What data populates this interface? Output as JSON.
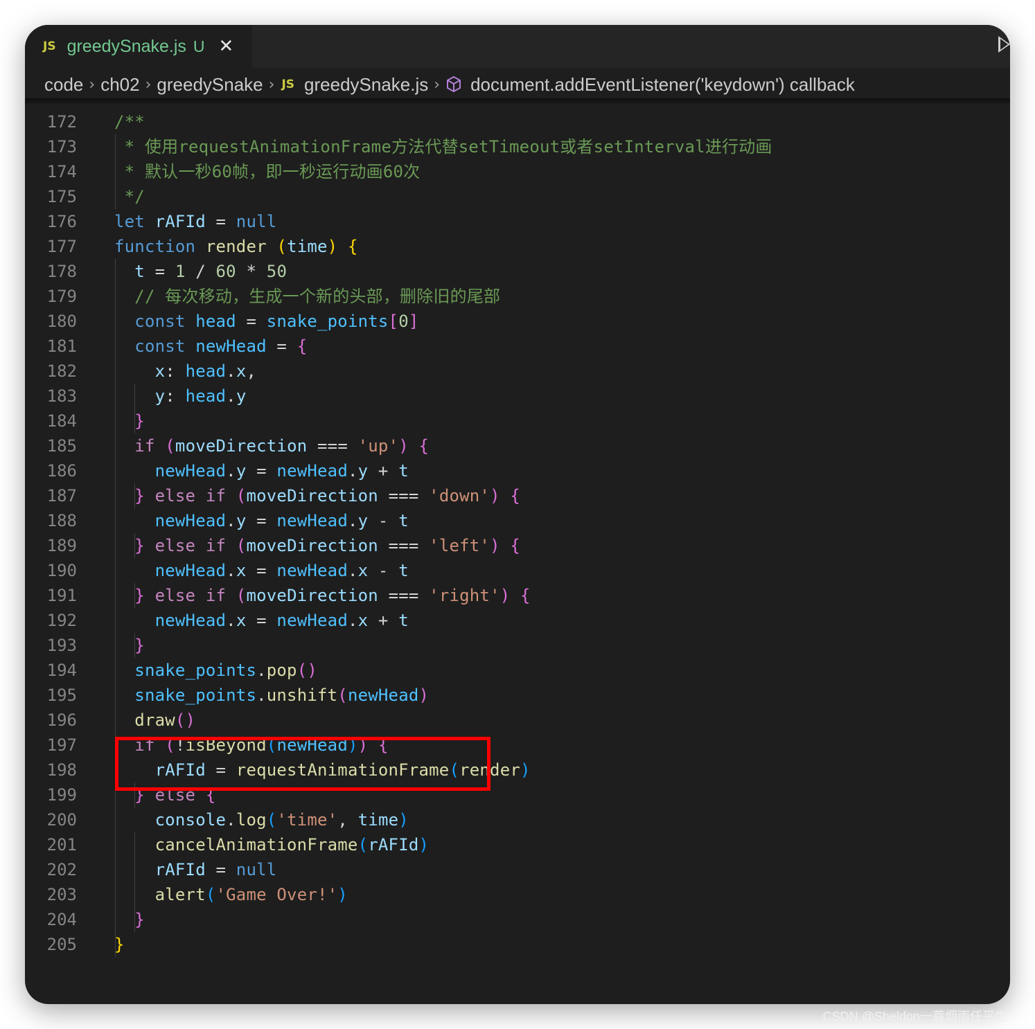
{
  "tab": {
    "icon_label": "JS",
    "title": "greedySnake.js",
    "status": "U",
    "close": "✕"
  },
  "breadcrumb": [
    "code",
    "ch02",
    "greedySnake",
    "greedySnake.js",
    "document.addEventListener('keydown') callback"
  ],
  "breadcrumb_js_badge": "JS",
  "watermark": "CSDN @Sheldon一蓑烟雨任平生",
  "lines": [
    {
      "num": "172",
      "tokens": [
        {
          "t": "/**",
          "c": "c"
        }
      ]
    },
    {
      "num": "173",
      "tokens": [
        {
          "t": " * 使用requestAnimationFrame方法代替setTimeout或者setInterval进行动画",
          "c": "c"
        }
      ]
    },
    {
      "num": "174",
      "tokens": [
        {
          "t": " * 默认一秒60帧，即一秒运行动画60次",
          "c": "c"
        }
      ]
    },
    {
      "num": "175",
      "tokens": [
        {
          "t": " */",
          "c": "c"
        }
      ]
    },
    {
      "num": "176",
      "tokens": [
        {
          "t": "let",
          "c": "k"
        },
        {
          "t": " rAFId ",
          "c": "v"
        },
        {
          "t": "=",
          "c": "o"
        },
        {
          "t": " null",
          "c": "k"
        }
      ]
    },
    {
      "num": "177",
      "tokens": [
        {
          "t": "function",
          "c": "k"
        },
        {
          "t": " render ",
          "c": "f"
        },
        {
          "t": "(",
          "c": "b1"
        },
        {
          "t": "time",
          "c": "v"
        },
        {
          "t": ")",
          "c": "b1"
        },
        {
          "t": " {",
          "c": "b1"
        }
      ]
    },
    {
      "num": "178",
      "tokens": [
        {
          "t": "  t ",
          "c": "v"
        },
        {
          "t": "= ",
          "c": "o"
        },
        {
          "t": "1",
          "c": "n"
        },
        {
          "t": " / ",
          "c": "o"
        },
        {
          "t": "60",
          "c": "n"
        },
        {
          "t": " * ",
          "c": "o"
        },
        {
          "t": "50",
          "c": "n"
        }
      ]
    },
    {
      "num": "179",
      "tokens": [
        {
          "t": "  // 每次移动，生成一个新的头部，删除旧的尾部",
          "c": "c"
        }
      ]
    },
    {
      "num": "180",
      "tokens": [
        {
          "t": "  const",
          "c": "k"
        },
        {
          "t": " head",
          "c": "cn"
        },
        {
          "t": " = ",
          "c": "o"
        },
        {
          "t": "snake_points",
          "c": "cn"
        },
        {
          "t": "[",
          "c": "b2"
        },
        {
          "t": "0",
          "c": "n"
        },
        {
          "t": "]",
          "c": "b2"
        }
      ]
    },
    {
      "num": "181",
      "tokens": [
        {
          "t": "  const",
          "c": "k"
        },
        {
          "t": " newHead",
          "c": "cn"
        },
        {
          "t": " = ",
          "c": "o"
        },
        {
          "t": "{",
          "c": "b2"
        }
      ]
    },
    {
      "num": "182",
      "tokens": [
        {
          "t": "    x",
          "c": "v"
        },
        {
          "t": ": ",
          "c": "o"
        },
        {
          "t": "head",
          "c": "cn"
        },
        {
          "t": ".",
          "c": "o"
        },
        {
          "t": "x",
          "c": "v"
        },
        {
          "t": ",",
          "c": "o"
        }
      ]
    },
    {
      "num": "183",
      "tokens": [
        {
          "t": "    y",
          "c": "v"
        },
        {
          "t": ": ",
          "c": "o"
        },
        {
          "t": "head",
          "c": "cn"
        },
        {
          "t": ".",
          "c": "o"
        },
        {
          "t": "y",
          "c": "v"
        }
      ]
    },
    {
      "num": "184",
      "tokens": [
        {
          "t": "  }",
          "c": "b2"
        }
      ]
    },
    {
      "num": "185",
      "tokens": [
        {
          "t": "  if",
          "c": "p"
        },
        {
          "t": " (",
          "c": "b2"
        },
        {
          "t": "moveDirection",
          "c": "v"
        },
        {
          "t": " === ",
          "c": "o"
        },
        {
          "t": "'up'",
          "c": "s"
        },
        {
          "t": ")",
          "c": "b2"
        },
        {
          "t": " {",
          "c": "b2"
        }
      ]
    },
    {
      "num": "186",
      "tokens": [
        {
          "t": "    newHead",
          "c": "cn"
        },
        {
          "t": ".",
          "c": "o"
        },
        {
          "t": "y",
          "c": "v"
        },
        {
          "t": " = ",
          "c": "o"
        },
        {
          "t": "newHead",
          "c": "cn"
        },
        {
          "t": ".",
          "c": "o"
        },
        {
          "t": "y",
          "c": "v"
        },
        {
          "t": " + ",
          "c": "o"
        },
        {
          "t": "t",
          "c": "v"
        }
      ]
    },
    {
      "num": "187",
      "tokens": [
        {
          "t": "  }",
          "c": "b2"
        },
        {
          "t": " else if",
          "c": "p"
        },
        {
          "t": " (",
          "c": "b2"
        },
        {
          "t": "moveDirection",
          "c": "v"
        },
        {
          "t": " === ",
          "c": "o"
        },
        {
          "t": "'down'",
          "c": "s"
        },
        {
          "t": ")",
          "c": "b2"
        },
        {
          "t": " {",
          "c": "b2"
        }
      ]
    },
    {
      "num": "188",
      "tokens": [
        {
          "t": "    newHead",
          "c": "cn"
        },
        {
          "t": ".",
          "c": "o"
        },
        {
          "t": "y",
          "c": "v"
        },
        {
          "t": " = ",
          "c": "o"
        },
        {
          "t": "newHead",
          "c": "cn"
        },
        {
          "t": ".",
          "c": "o"
        },
        {
          "t": "y",
          "c": "v"
        },
        {
          "t": " - ",
          "c": "o"
        },
        {
          "t": "t",
          "c": "v"
        }
      ]
    },
    {
      "num": "189",
      "tokens": [
        {
          "t": "  }",
          "c": "b2"
        },
        {
          "t": " else if",
          "c": "p"
        },
        {
          "t": " (",
          "c": "b2"
        },
        {
          "t": "moveDirection",
          "c": "v"
        },
        {
          "t": " === ",
          "c": "o"
        },
        {
          "t": "'left'",
          "c": "s"
        },
        {
          "t": ")",
          "c": "b2"
        },
        {
          "t": " {",
          "c": "b2"
        }
      ]
    },
    {
      "num": "190",
      "tokens": [
        {
          "t": "    newHead",
          "c": "cn"
        },
        {
          "t": ".",
          "c": "o"
        },
        {
          "t": "x",
          "c": "v"
        },
        {
          "t": " = ",
          "c": "o"
        },
        {
          "t": "newHead",
          "c": "cn"
        },
        {
          "t": ".",
          "c": "o"
        },
        {
          "t": "x",
          "c": "v"
        },
        {
          "t": " - ",
          "c": "o"
        },
        {
          "t": "t",
          "c": "v"
        }
      ]
    },
    {
      "num": "191",
      "tokens": [
        {
          "t": "  }",
          "c": "b2"
        },
        {
          "t": " else if",
          "c": "p"
        },
        {
          "t": " (",
          "c": "b2"
        },
        {
          "t": "moveDirection",
          "c": "v"
        },
        {
          "t": " === ",
          "c": "o"
        },
        {
          "t": "'right'",
          "c": "s"
        },
        {
          "t": ")",
          "c": "b2"
        },
        {
          "t": " {",
          "c": "b2"
        }
      ]
    },
    {
      "num": "192",
      "tokens": [
        {
          "t": "    newHead",
          "c": "cn"
        },
        {
          "t": ".",
          "c": "o"
        },
        {
          "t": "x",
          "c": "v"
        },
        {
          "t": " = ",
          "c": "o"
        },
        {
          "t": "newHead",
          "c": "cn"
        },
        {
          "t": ".",
          "c": "o"
        },
        {
          "t": "x",
          "c": "v"
        },
        {
          "t": " + ",
          "c": "o"
        },
        {
          "t": "t",
          "c": "v"
        }
      ]
    },
    {
      "num": "193",
      "tokens": [
        {
          "t": "  }",
          "c": "b2"
        }
      ]
    },
    {
      "num": "194",
      "tokens": [
        {
          "t": "  snake_points",
          "c": "cn"
        },
        {
          "t": ".",
          "c": "o"
        },
        {
          "t": "pop",
          "c": "f"
        },
        {
          "t": "()",
          "c": "b2"
        }
      ]
    },
    {
      "num": "195",
      "tokens": [
        {
          "t": "  snake_points",
          "c": "cn"
        },
        {
          "t": ".",
          "c": "o"
        },
        {
          "t": "unshift",
          "c": "f"
        },
        {
          "t": "(",
          "c": "b2"
        },
        {
          "t": "newHead",
          "c": "cn"
        },
        {
          "t": ")",
          "c": "b2"
        }
      ]
    },
    {
      "num": "196",
      "tokens": [
        {
          "t": "  draw",
          "c": "f"
        },
        {
          "t": "()",
          "c": "b2"
        }
      ]
    },
    {
      "num": "197",
      "tokens": [
        {
          "t": "  if",
          "c": "p"
        },
        {
          "t": " (",
          "c": "b2"
        },
        {
          "t": "!",
          "c": "o"
        },
        {
          "t": "isBeyond",
          "c": "f"
        },
        {
          "t": "(",
          "c": "b3"
        },
        {
          "t": "newHead",
          "c": "cn"
        },
        {
          "t": ")",
          "c": "b3"
        },
        {
          "t": ")",
          "c": "b2"
        },
        {
          "t": " {",
          "c": "b2"
        }
      ]
    },
    {
      "num": "198",
      "tokens": [
        {
          "t": "    rAFId",
          "c": "v"
        },
        {
          "t": " = ",
          "c": "o"
        },
        {
          "t": "requestAnimationFrame",
          "c": "f"
        },
        {
          "t": "(",
          "c": "b3"
        },
        {
          "t": "render",
          "c": "f"
        },
        {
          "t": ")",
          "c": "b3"
        }
      ]
    },
    {
      "num": "199",
      "tokens": [
        {
          "t": "  }",
          "c": "b2"
        },
        {
          "t": " else",
          "c": "p"
        },
        {
          "t": " {",
          "c": "b2"
        }
      ]
    },
    {
      "num": "200",
      "tokens": [
        {
          "t": "    console",
          "c": "v"
        },
        {
          "t": ".",
          "c": "o"
        },
        {
          "t": "log",
          "c": "f"
        },
        {
          "t": "(",
          "c": "b3"
        },
        {
          "t": "'time'",
          "c": "s"
        },
        {
          "t": ", ",
          "c": "o"
        },
        {
          "t": "time",
          "c": "v"
        },
        {
          "t": ")",
          "c": "b3"
        }
      ]
    },
    {
      "num": "201",
      "tokens": [
        {
          "t": "    cancelAnimationFrame",
          "c": "f"
        },
        {
          "t": "(",
          "c": "b3"
        },
        {
          "t": "rAFId",
          "c": "v"
        },
        {
          "t": ")",
          "c": "b3"
        }
      ]
    },
    {
      "num": "202",
      "tokens": [
        {
          "t": "    rAFId",
          "c": "v"
        },
        {
          "t": " = ",
          "c": "o"
        },
        {
          "t": "null",
          "c": "k"
        }
      ]
    },
    {
      "num": "203",
      "tokens": [
        {
          "t": "    alert",
          "c": "f"
        },
        {
          "t": "(",
          "c": "b3"
        },
        {
          "t": "'Game Over!'",
          "c": "s"
        },
        {
          "t": ")",
          "c": "b3"
        }
      ]
    },
    {
      "num": "204",
      "tokens": [
        {
          "t": "  }",
          "c": "b2"
        }
      ]
    },
    {
      "num": "205",
      "tokens": [
        {
          "t": "}",
          "c": "b1"
        }
      ]
    }
  ],
  "highlight": {
    "from_line": "194",
    "to_line": "195",
    "color": "#ff0000"
  },
  "colors": {
    "editor_bg": "#1e1e1e",
    "tab_modified": "#73c991",
    "js_badge": "#cbcb41"
  }
}
